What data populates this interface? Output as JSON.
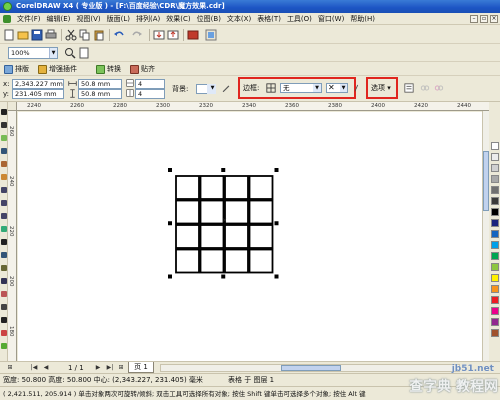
{
  "window": {
    "title": "CorelDRAW X4 ( 专业版 ) - [F:\\百度经验\\CDR\\魔方效果.cdr]"
  },
  "menu": {
    "items": [
      "文件(F)",
      "编辑(E)",
      "视图(V)",
      "版面(L)",
      "排列(A)",
      "效果(C)",
      "位图(B)",
      "文本(X)",
      "表格(T)",
      "工具(O)",
      "窗口(W)",
      "帮助(H)"
    ]
  },
  "toolbar": {
    "zoom_value": "100%"
  },
  "docker_bar": {
    "items": [
      "排版",
      "增强插件",
      "转换",
      "贴齐"
    ]
  },
  "property_bar": {
    "x_value": "2,343.227 mm",
    "y_value": "231.405 mm",
    "width_value": "50.8 mm",
    "height_value": "50.8 mm",
    "rows_value": "4",
    "cols_value": "4",
    "background_label": "背景:",
    "border_label": "边框:",
    "border_value": "无",
    "options_label": "选项"
  },
  "ruler": {
    "h_labels": [
      "2240",
      "2260",
      "2280",
      "2300",
      "2320",
      "2340",
      "2360",
      "2380",
      "2400",
      "2420",
      "2440"
    ],
    "v_labels": [
      "260",
      "240",
      "220",
      "200",
      "180"
    ]
  },
  "document": {
    "page_count": "1 / 1",
    "page_tab": "页 1"
  },
  "status": {
    "dimensions": "宽度: 50.800  高度: 50.800  中心: (2,343.227, 231.405)  毫米",
    "object_info": "表格 于 图层 1",
    "cursor_hint": "( 2,421.511, 205.914 )  单击对象两次可旋转/倾斜; 双击工具可选择所有对象; 按住 Shift 键单击可选择多个对象; 按住 Alt 键",
    "watermark": "查字典 教程网",
    "watermark_url": "jb51.net"
  },
  "colors": {
    "title_bar": "#1d55c4",
    "highlight_box": "#e0261f",
    "palette": [
      "#ffffff",
      "#ececec",
      "#d0d0d0",
      "#a8a8a8",
      "#707070",
      "#3a3a3a",
      "#000000",
      "#1a237e",
      "#1565c0",
      "#00a0e9",
      "#00a651",
      "#8dc63f",
      "#fff200",
      "#f7941d",
      "#ed1c24",
      "#ec008c",
      "#92278f",
      "#a0522d"
    ]
  }
}
